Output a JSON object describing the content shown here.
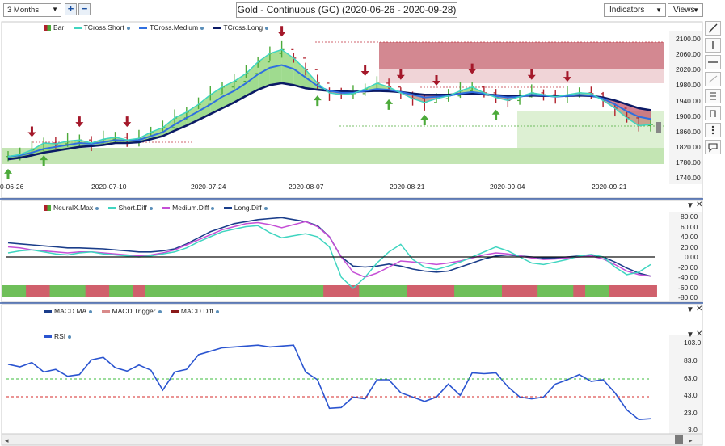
{
  "toolbar": {
    "range_value": "3 Months",
    "zoom_in_label": "+",
    "zoom_out_label": "−",
    "title": "Gold - Continuous (GC) (2020-06-26 - 2020-09-28)",
    "indicators_label": "Indicators",
    "views_label": "Views"
  },
  "price_pane": {
    "legend": [
      "Bar",
      "TCross.Short",
      "TCross.Medium",
      "TCross.Long"
    ],
    "y_labels": [
      "2100.00",
      "2060.00",
      "2020.00",
      "1980.00",
      "1940.00",
      "1900.00",
      "1860.00",
      "1820.00",
      "1780.00",
      "1740.00"
    ],
    "x_labels": [
      "0-06-26",
      "2020-07-10",
      "2020-07-24",
      "2020-08-07",
      "2020-08-21",
      "2020-09-04",
      "2020-09-21"
    ]
  },
  "neural_pane": {
    "legend": [
      "NeuralX.Max",
      "Short.Diff",
      "Medium.Diff",
      "Long.Diff"
    ],
    "y_labels": [
      "80.00",
      "60.00",
      "40.00",
      "20.00",
      "0.00",
      "-20.00",
      "-40.00",
      "-60.00",
      "-80.00"
    ]
  },
  "macd_pane": {
    "legend": [
      "MACD.MA",
      "MACD.Trigger",
      "MACD.Diff"
    ]
  },
  "rsi_pane": {
    "legend": [
      "RSI"
    ],
    "y_labels": [
      "103.0",
      "83.0",
      "63.0",
      "43.0",
      "23.0",
      "3.0"
    ]
  },
  "colors": {
    "short": "#3fd5c0",
    "medium": "#2f6fe0",
    "long": "#0b1a66",
    "bull": "#4caa3a",
    "bear": "#b0202c",
    "magenta": "#c54fd6",
    "rsi": "#2a54d0"
  },
  "icons": [
    "pencil-icon",
    "vertical-line-icon",
    "horizontal-line-icon",
    "trend-line-icon",
    "fibonacci-icon",
    "dots-icon",
    "comment-icon",
    "pane-close-icon",
    "scroll-left-icon",
    "scroll-right-icon"
  ],
  "series": {
    "short": [
      1795,
      1800,
      1812,
      1830,
      1828,
      1835,
      1838,
      1830,
      1840,
      1845,
      1838,
      1842,
      1858,
      1870,
      1895,
      1910,
      1930,
      1955,
      1975,
      1990,
      2010,
      2040,
      2062,
      2072,
      2050,
      2020,
      1985,
      1960,
      1955,
      1958,
      1970,
      1985,
      1975,
      1960,
      1945,
      1935,
      1945,
      1952,
      1965,
      1975,
      1960,
      1948,
      1940,
      1950,
      1960,
      1955,
      1950,
      1955,
      1960,
      1958,
      1940,
      1920,
      1895,
      1875,
      1878
    ],
    "medium": [
      1795,
      1798,
      1805,
      1815,
      1820,
      1825,
      1830,
      1828,
      1832,
      1838,
      1836,
      1838,
      1848,
      1858,
      1878,
      1895,
      1912,
      1930,
      1950,
      1965,
      1985,
      2008,
      2025,
      2032,
      2022,
      2000,
      1978,
      1965,
      1960,
      1960,
      1965,
      1970,
      1968,
      1962,
      1955,
      1948,
      1950,
      1952,
      1958,
      1962,
      1958,
      1952,
      1948,
      1950,
      1955,
      1953,
      1950,
      1952,
      1955,
      1953,
      1945,
      1930,
      1912,
      1898,
      1892
    ],
    "long": [
      1788,
      1792,
      1798,
      1805,
      1810,
      1815,
      1820,
      1822,
      1825,
      1830,
      1830,
      1832,
      1840,
      1848,
      1862,
      1875,
      1890,
      1905,
      1920,
      1935,
      1952,
      1968,
      1980,
      1985,
      1980,
      1972,
      1968,
      1965,
      1964,
      1963,
      1964,
      1965,
      1964,
      1962,
      1958,
      1955,
      1955,
      1955,
      1957,
      1958,
      1956,
      1954,
      1952,
      1952,
      1953,
      1952,
      1952,
      1952,
      1953,
      1952,
      1948,
      1940,
      1930,
      1920,
      1915
    ],
    "short_diff": [
      8,
      12,
      14,
      10,
      6,
      4,
      8,
      10,
      6,
      4,
      2,
      0,
      2,
      6,
      10,
      18,
      30,
      40,
      50,
      55,
      60,
      62,
      48,
      38,
      42,
      46,
      40,
      20,
      -40,
      -62,
      -40,
      -12,
      10,
      25,
      -5,
      -20,
      -25,
      -18,
      -10,
      0,
      10,
      20,
      12,
      0,
      -12,
      -15,
      -10,
      -5,
      2,
      5,
      0,
      -20,
      -35,
      -30,
      -15
    ],
    "medium_diff": [
      20,
      18,
      14,
      12,
      10,
      8,
      10,
      10,
      8,
      6,
      4,
      2,
      4,
      8,
      14,
      24,
      34,
      44,
      54,
      60,
      66,
      68,
      64,
      58,
      64,
      70,
      60,
      40,
      0,
      -30,
      -40,
      -32,
      -20,
      -8,
      -10,
      -12,
      -15,
      -12,
      -8,
      -2,
      4,
      8,
      6,
      2,
      -2,
      -5,
      -4,
      -2,
      0,
      2,
      -4,
      -15,
      -28,
      -35,
      -38
    ],
    "long_diff": [
      28,
      26,
      24,
      22,
      20,
      18,
      18,
      17,
      16,
      14,
      12,
      10,
      10,
      12,
      16,
      26,
      38,
      50,
      58,
      66,
      70,
      74,
      76,
      78,
      74,
      70,
      62,
      40,
      0,
      -18,
      -20,
      -18,
      -14,
      -18,
      -24,
      -28,
      -30,
      -28,
      -20,
      -12,
      -4,
      2,
      4,
      2,
      0,
      -2,
      -2,
      0,
      2,
      4,
      0,
      -10,
      -22,
      -32,
      -38
    ],
    "rsi": [
      78,
      75,
      80,
      69,
      72,
      64,
      66,
      83,
      86,
      74,
      70,
      77,
      71,
      48,
      69,
      72,
      89,
      93,
      97,
      98,
      99,
      100,
      98,
      99,
      100,
      69,
      60,
      27,
      28,
      40,
      38,
      60,
      60,
      45,
      40,
      35,
      40,
      55,
      42,
      68,
      67,
      68,
      52,
      40,
      38,
      40,
      55,
      60,
      66,
      58,
      60,
      45,
      25,
      14,
      15
    ]
  },
  "bands": {
    "neural_colors": [
      "g",
      "g",
      "r",
      "r",
      "g",
      "g",
      "g",
      "r",
      "r",
      "g",
      "g",
      "r",
      "g",
      "g",
      "g",
      "g",
      "g",
      "g",
      "g",
      "g",
      "g",
      "g",
      "g",
      "g",
      "g",
      "g",
      "g",
      "r",
      "r",
      "r",
      "g",
      "g",
      "g",
      "g",
      "r",
      "r",
      "r",
      "r",
      "g",
      "g",
      "g",
      "g",
      "r",
      "r",
      "r",
      "g",
      "g",
      "g",
      "r",
      "g",
      "g",
      "r",
      "r",
      "r",
      "r"
    ]
  }
}
